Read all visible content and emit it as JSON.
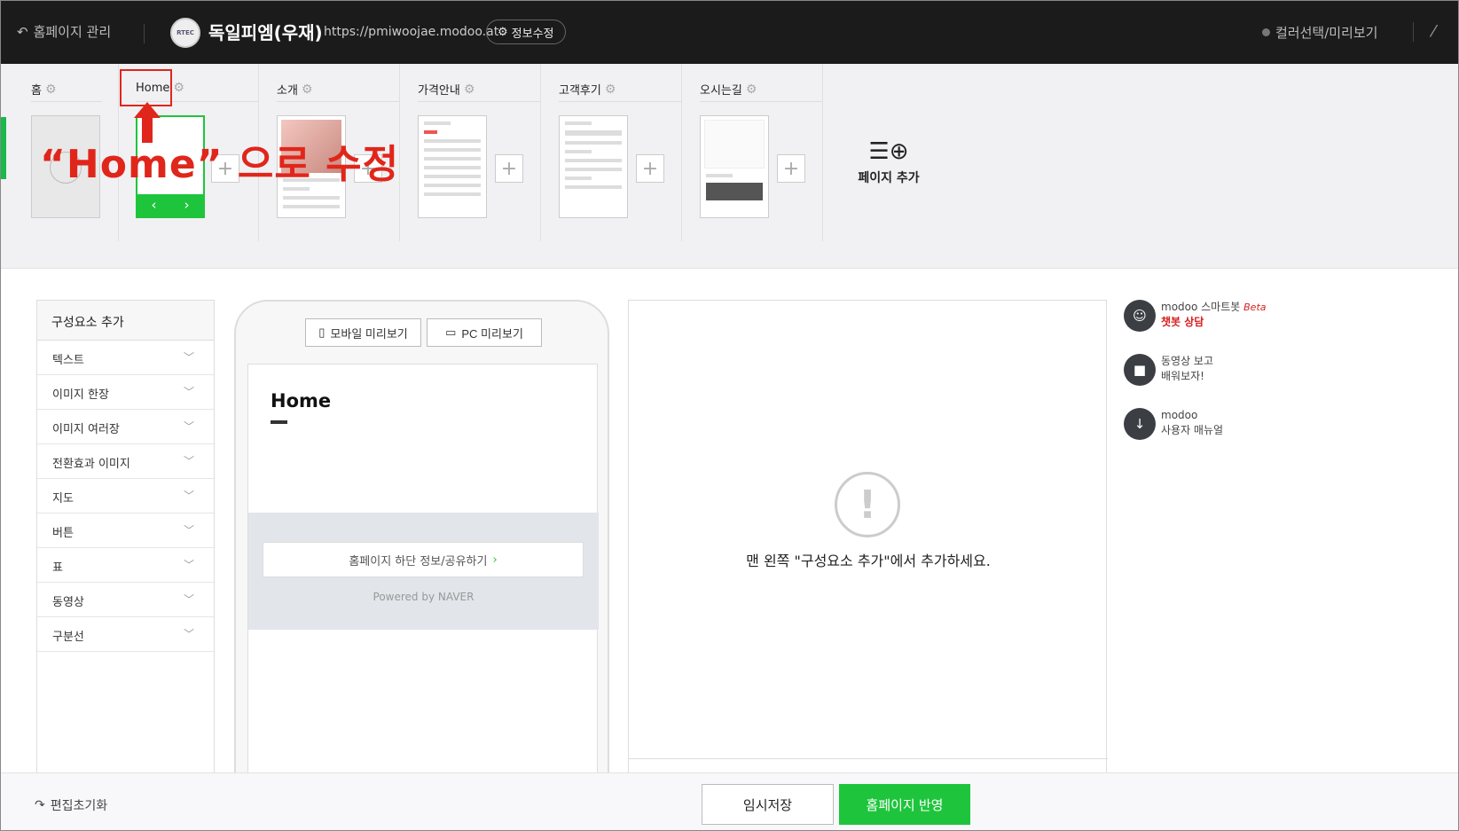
{
  "topbar": {
    "back_label": "홈페이지 관리",
    "logo_text": "RTEC",
    "site_name": "독일피엠(우재)",
    "site_url": "https://pmiwoojae.modoo.at",
    "info_edit_label": "정보수정",
    "color_preview_label": "컬러선택/미리보기"
  },
  "pages": [
    {
      "name": "홈"
    },
    {
      "name": "Home"
    },
    {
      "name": "소개"
    },
    {
      "name": "가격안내"
    },
    {
      "name": "고객후기"
    },
    {
      "name": "오시는길"
    }
  ],
  "add_page_label": "페이지 추가",
  "annotation": {
    "text": "“Home” 으로 수정",
    "color": "#e0261b"
  },
  "components": {
    "header": "구성요소 추가",
    "items": [
      "텍스트",
      "이미지 한장",
      "이미지 여러장",
      "전환효과 이미지",
      "지도",
      "버튼",
      "표",
      "동영상",
      "구분선"
    ]
  },
  "preview": {
    "mobile_label": "모바일 미리보기",
    "pc_label": "PC 미리보기",
    "page_title": "Home",
    "footer_button": "홈페이지 하단 정보/공유하기",
    "powered": "Powered by NAVER"
  },
  "editor": {
    "empty_message": "맨 왼쪽 \"구성요소 추가\"에서 추가하세요."
  },
  "help": {
    "chatbot_line1": "modoo 스마트봇",
    "chatbot_beta": "Beta",
    "chatbot_line2": "챗봇 상담",
    "video_line1": "동영상 보고",
    "video_line2": "배워보자!",
    "manual_line1": "modoo",
    "manual_line2": "사용자 매뉴얼"
  },
  "bottom": {
    "reset_label": "편집초기화",
    "save_temp_label": "임시저장",
    "publish_label": "홈페이지 반영"
  },
  "colors": {
    "accent_green": "#1ec53c",
    "topbar_bg": "#1b1b1b"
  }
}
